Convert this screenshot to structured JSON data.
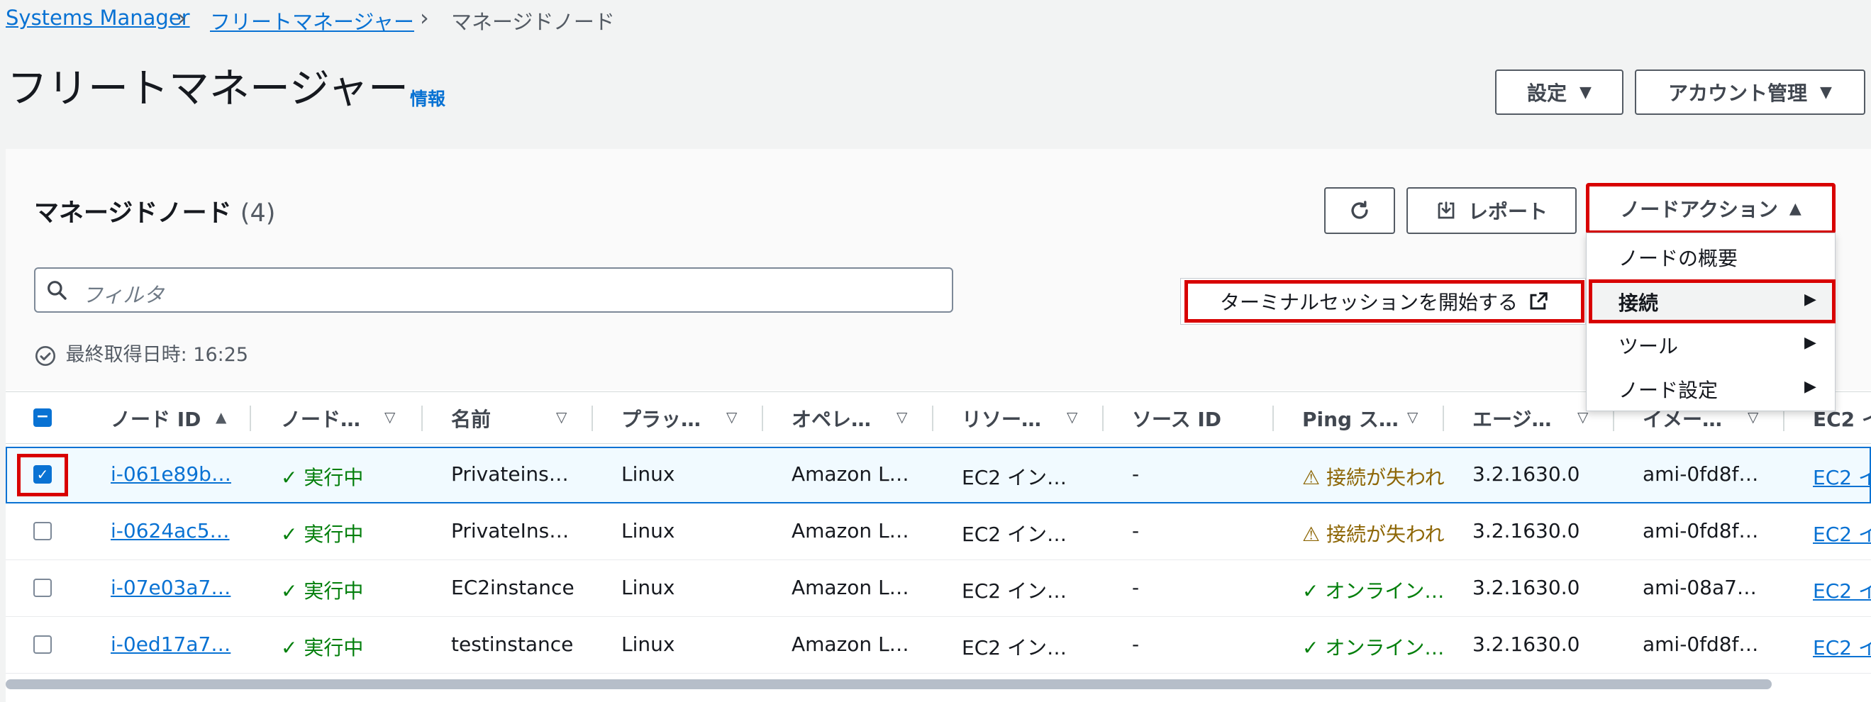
{
  "breadcrumb": {
    "root": "Systems Manager",
    "parent": "フリートマネージャー",
    "current": "マネージドノード",
    "separator": "›"
  },
  "header": {
    "title": "フリートマネージャー",
    "info": "情報",
    "settings_label": "設定",
    "account_label": "アカウント管理"
  },
  "section": {
    "title": "マネージドノード",
    "count": "(4)",
    "refresh_icon": "refresh-icon",
    "report_label": "レポート",
    "node_actions_label": "ノードアクション",
    "filter_placeholder": "フィルタ",
    "last_fetched": "最終取得日時: 16:25"
  },
  "menu": {
    "items": [
      {
        "label": "ノードの概要",
        "has_submenu": false
      },
      {
        "label": "接続",
        "has_submenu": true
      },
      {
        "label": "ツール",
        "has_submenu": true
      },
      {
        "label": "ノード設定",
        "has_submenu": true
      }
    ],
    "submenu_item": "ターミナルセッションを開始する"
  },
  "table": {
    "columns": [
      "ノード ID",
      "ノード…",
      "名前",
      "プラッ…",
      "オペレ…",
      "リソー…",
      "ソース ID",
      "Ping ス…",
      "エージ…",
      "イメー…",
      "EC2 イ"
    ],
    "rows": [
      {
        "selected": true,
        "id": "i-061e89b…",
        "state": "実行中",
        "name": "Privateins…",
        "platform": "Linux",
        "os": "Amazon L…",
        "resource": "EC2 イン…",
        "source": "-",
        "ping": "接続が失われ",
        "ping_ok": false,
        "agent": "3.2.1630.0",
        "image": "ami-0fd8f…",
        "ec2": "EC2 イ"
      },
      {
        "selected": false,
        "id": "i-0624ac5…",
        "state": "実行中",
        "name": "PrivateIns…",
        "platform": "Linux",
        "os": "Amazon L…",
        "resource": "EC2 イン…",
        "source": "-",
        "ping": "接続が失われ",
        "ping_ok": false,
        "agent": "3.2.1630.0",
        "image": "ami-0fd8f…",
        "ec2": "EC2 イ"
      },
      {
        "selected": false,
        "id": "i-07e03a7…",
        "state": "実行中",
        "name": "EC2instance",
        "platform": "Linux",
        "os": "Amazon L…",
        "resource": "EC2 イン…",
        "source": "-",
        "ping": "オンライン…",
        "ping_ok": true,
        "agent": "3.2.1630.0",
        "image": "ami-08a7…",
        "ec2": "EC2 イ"
      },
      {
        "selected": false,
        "id": "i-0ed17a7…",
        "state": "実行中",
        "name": "testinstance",
        "platform": "Linux",
        "os": "Amazon L…",
        "resource": "EC2 イン…",
        "source": "-",
        "ping": "オンライン…",
        "ping_ok": true,
        "agent": "3.2.1630.0",
        "image": "ami-0fd8f…",
        "ec2": "EC2 イ"
      }
    ]
  },
  "colors": {
    "link": "#0972d3",
    "success": "#037f0c",
    "warning": "#8d6605",
    "highlight": "#d80000"
  }
}
